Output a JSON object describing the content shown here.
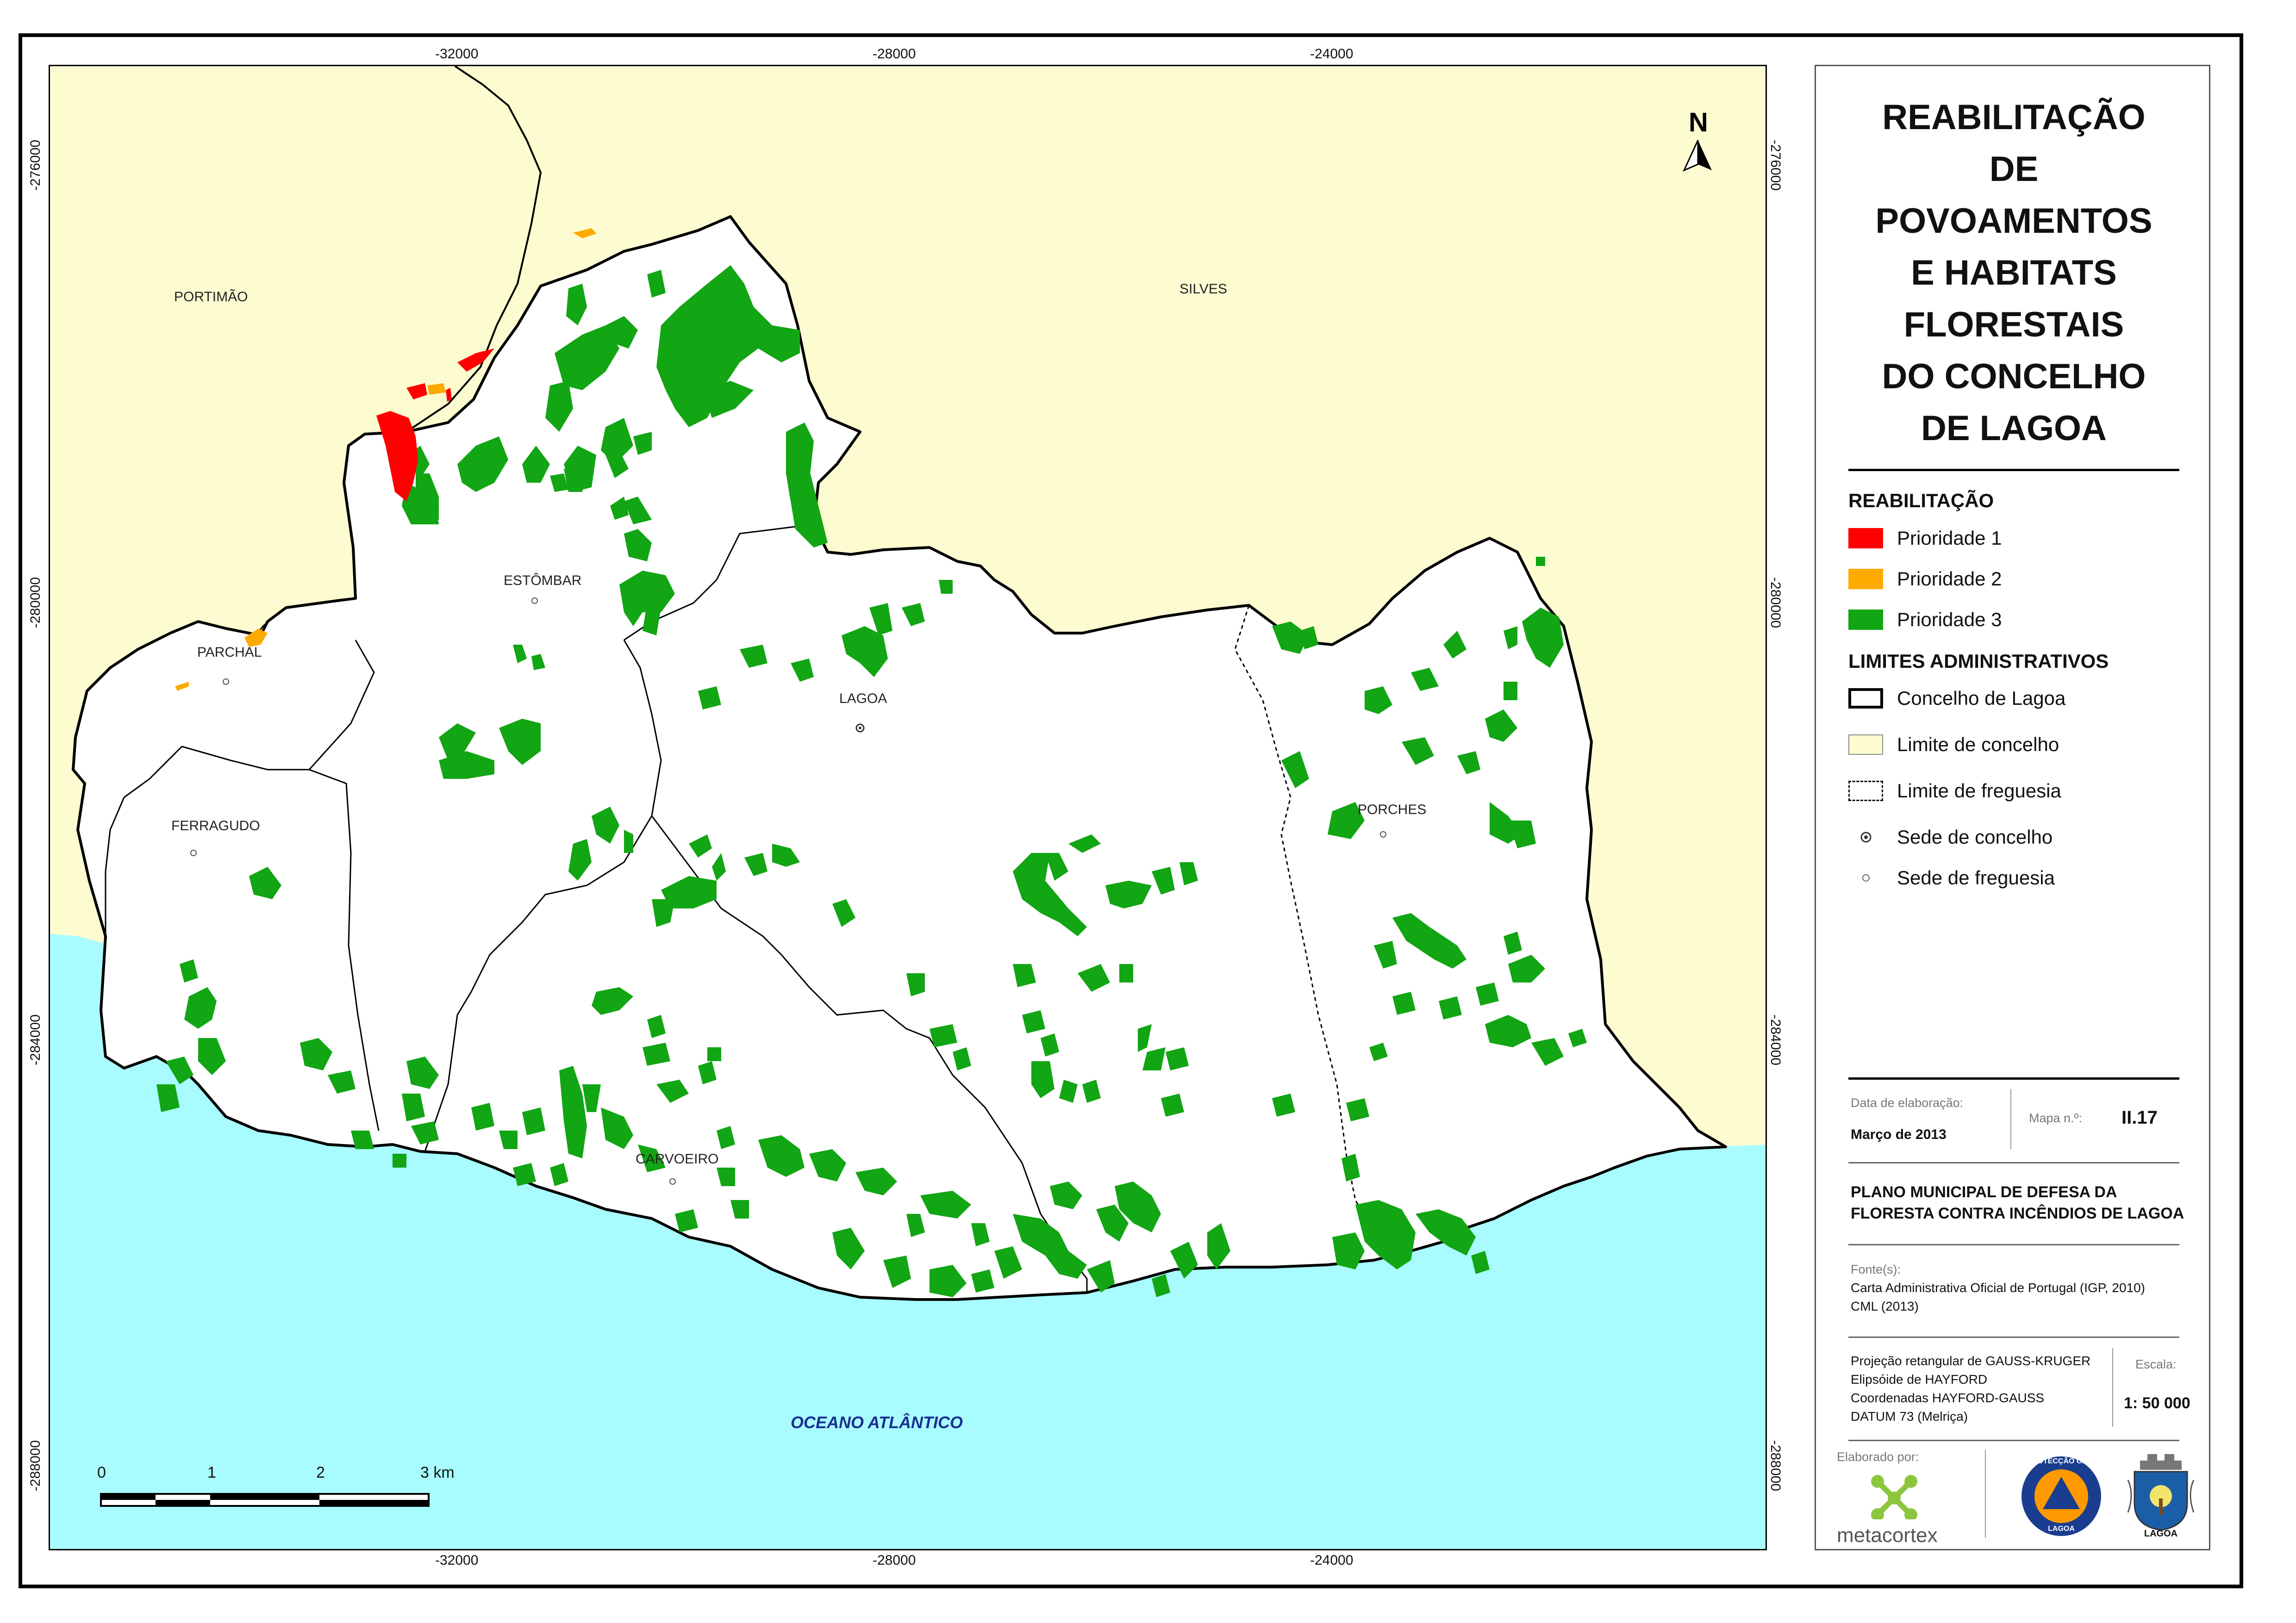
{
  "map": {
    "top_ticks": [
      "-32000",
      "-28000",
      "-24000"
    ],
    "bottom_ticks": [
      "-32000",
      "-28000",
      "-24000"
    ],
    "left_ticks": [
      "-276000",
      "-280000",
      "-284000",
      "-288000"
    ],
    "right_ticks": [
      "-276000",
      "-280000",
      "-284000",
      "-288000"
    ],
    "place_labels": {
      "portimao": "PORTIMÃO",
      "silves": "SILVES",
      "estombar": "ESTÔMBAR",
      "parchal": "PARCHAL",
      "lagoa": "LAGOA",
      "ferragudo": "FERRAGUDO",
      "porches": "PORCHES",
      "carvoeiro": "CARVOEIRO",
      "ocean": "OCEANO ATLÂNTICO"
    },
    "north_arrow_label": "N",
    "scalebar": {
      "labels": [
        "0",
        "1",
        "2",
        "3 km"
      ]
    },
    "colors": {
      "neighbour_land": "#fdfbd0",
      "ocean": "#a8fcff",
      "municipality": "#ffffff",
      "priority_1": "#ff0000",
      "priority_2": "#ffaa00",
      "priority_3": "#12a514"
    }
  },
  "panel": {
    "title_lines": [
      "REABILITAÇÃO",
      "DE",
      "POVOAMENTOS",
      "E HABITATS",
      "FLORESTAIS",
      "DO CONCELHO",
      "DE LAGOA"
    ],
    "rehab_heading": "REABILITAÇÃO",
    "rehab_items": [
      {
        "label": "Prioridade 1",
        "color": "#ff0000"
      },
      {
        "label": "Prioridade 2",
        "color": "#ffaa00"
      },
      {
        "label": "Prioridade 3",
        "color": "#12a514"
      }
    ],
    "admin_heading": "LIMITES ADMINISTRATIVOS",
    "admin_items": [
      {
        "label": "Concelho de Lagoa",
        "symbol": "thick-outline"
      },
      {
        "label": "Limite de concelho",
        "symbol": "cream-fill"
      },
      {
        "label": "Limite de freguesia",
        "symbol": "dotted-outline"
      },
      {
        "label": "Sede de concelho",
        "symbol": "ring-dot"
      },
      {
        "label": "Sede de freguesia",
        "symbol": "small-dot"
      }
    ],
    "date_label": "Data de elaboração:",
    "date_value": "Março de 2013",
    "map_no_label": "Mapa n.º:",
    "map_no_value": "II.17",
    "plan_lines": [
      "PLANO MUNICIPAL DE DEFESA DA",
      "FLORESTA CONTRA INCÊNDIOS DE LAGOA"
    ],
    "sources_label": "Fonte(s):",
    "sources": [
      "Carta Administrativa Oficial de Portugal (IGP, 2010)",
      "CML (2013)"
    ],
    "projection": [
      "Projeção retangular de GAUSS-KRUGER",
      "Elipsóide de HAYFORD",
      "Coordenadas HAYFORD-GAUSS",
      "DATUM 73 (Melriça)"
    ],
    "scale_label": "Escala:",
    "scale_value": "1: 50 000",
    "made_by_label": "Elaborado por:",
    "company": "metacortex",
    "logo_protecao_text": "PROTECÇÃO CIVIL",
    "logo_lagoa_text": "LAGOA",
    "logo_crest_text": "LAGOA"
  }
}
